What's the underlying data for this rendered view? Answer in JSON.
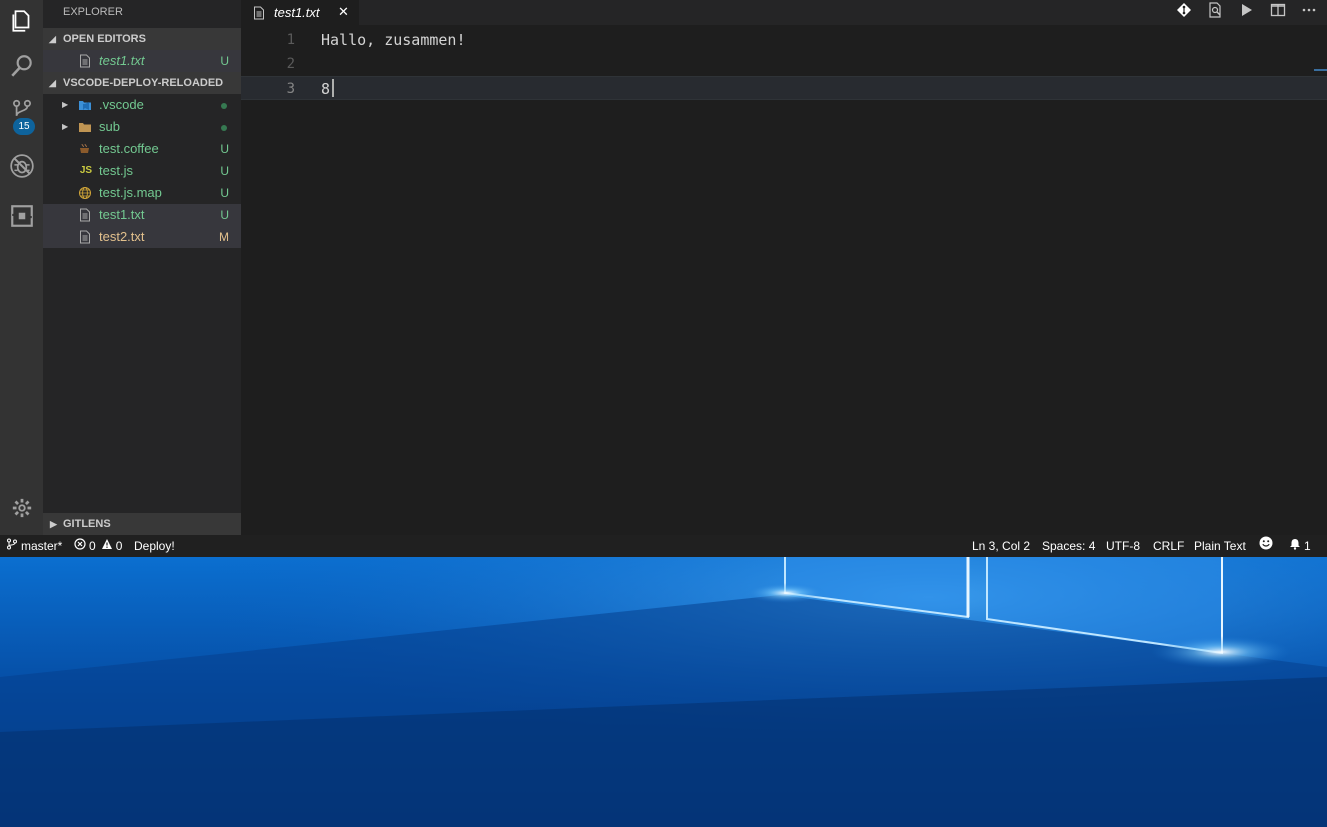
{
  "activity_bar": {
    "items": [
      "files-icon",
      "search-icon",
      "source-control-icon",
      "debug-icon",
      "extensions-icon"
    ],
    "scm_badge": "15",
    "bottom": "gear-icon"
  },
  "sidebar": {
    "title": "EXPLORER",
    "open_editors": {
      "header": "OPEN EDITORS",
      "items": [
        {
          "name": "test1.txt",
          "status": "U"
        }
      ]
    },
    "workspace": {
      "header": "VSCODE-DEPLOY-RELOADED",
      "items": [
        {
          "name": ".vscode",
          "status": "",
          "icon": "vscode-folder-icon"
        },
        {
          "name": "sub",
          "status": "",
          "icon": "folder-icon"
        },
        {
          "name": "test.coffee",
          "status": "U",
          "icon": "coffee-icon"
        },
        {
          "name": "test.js",
          "status": "U",
          "icon": "js-icon",
          "icon_text": "JS"
        },
        {
          "name": "test.js.map",
          "status": "U",
          "icon": "globe-icon"
        },
        {
          "name": "test1.txt",
          "status": "U",
          "icon": "file-icon"
        },
        {
          "name": "test2.txt",
          "status": "M",
          "icon": "file-icon"
        }
      ]
    },
    "gitlens": {
      "header": "GITLENS"
    }
  },
  "tabs": [
    {
      "label": "test1.txt",
      "close": "✕"
    }
  ],
  "editor_actions": [
    "git-compare-icon",
    "open-preview-icon",
    "run-icon",
    "split-editor-icon",
    "more-icon"
  ],
  "editor": {
    "lines": [
      {
        "number": "1",
        "text": "Hallo, zusammen!"
      },
      {
        "number": "2",
        "text": ""
      },
      {
        "number": "3",
        "text": "8"
      }
    ]
  },
  "statusbar": {
    "branch": "master*",
    "errors": "0",
    "warnings": "0",
    "deploy": "Deploy!",
    "position": "Ln 3, Col 2",
    "spaces": "Spaces: 4",
    "encoding": "UTF-8",
    "eol": "CRLF",
    "language": "Plain Text",
    "notifications": "1"
  },
  "colors": {
    "untracked": "#73c991",
    "modified": "#e2c08d",
    "badge": "#0e639c"
  }
}
